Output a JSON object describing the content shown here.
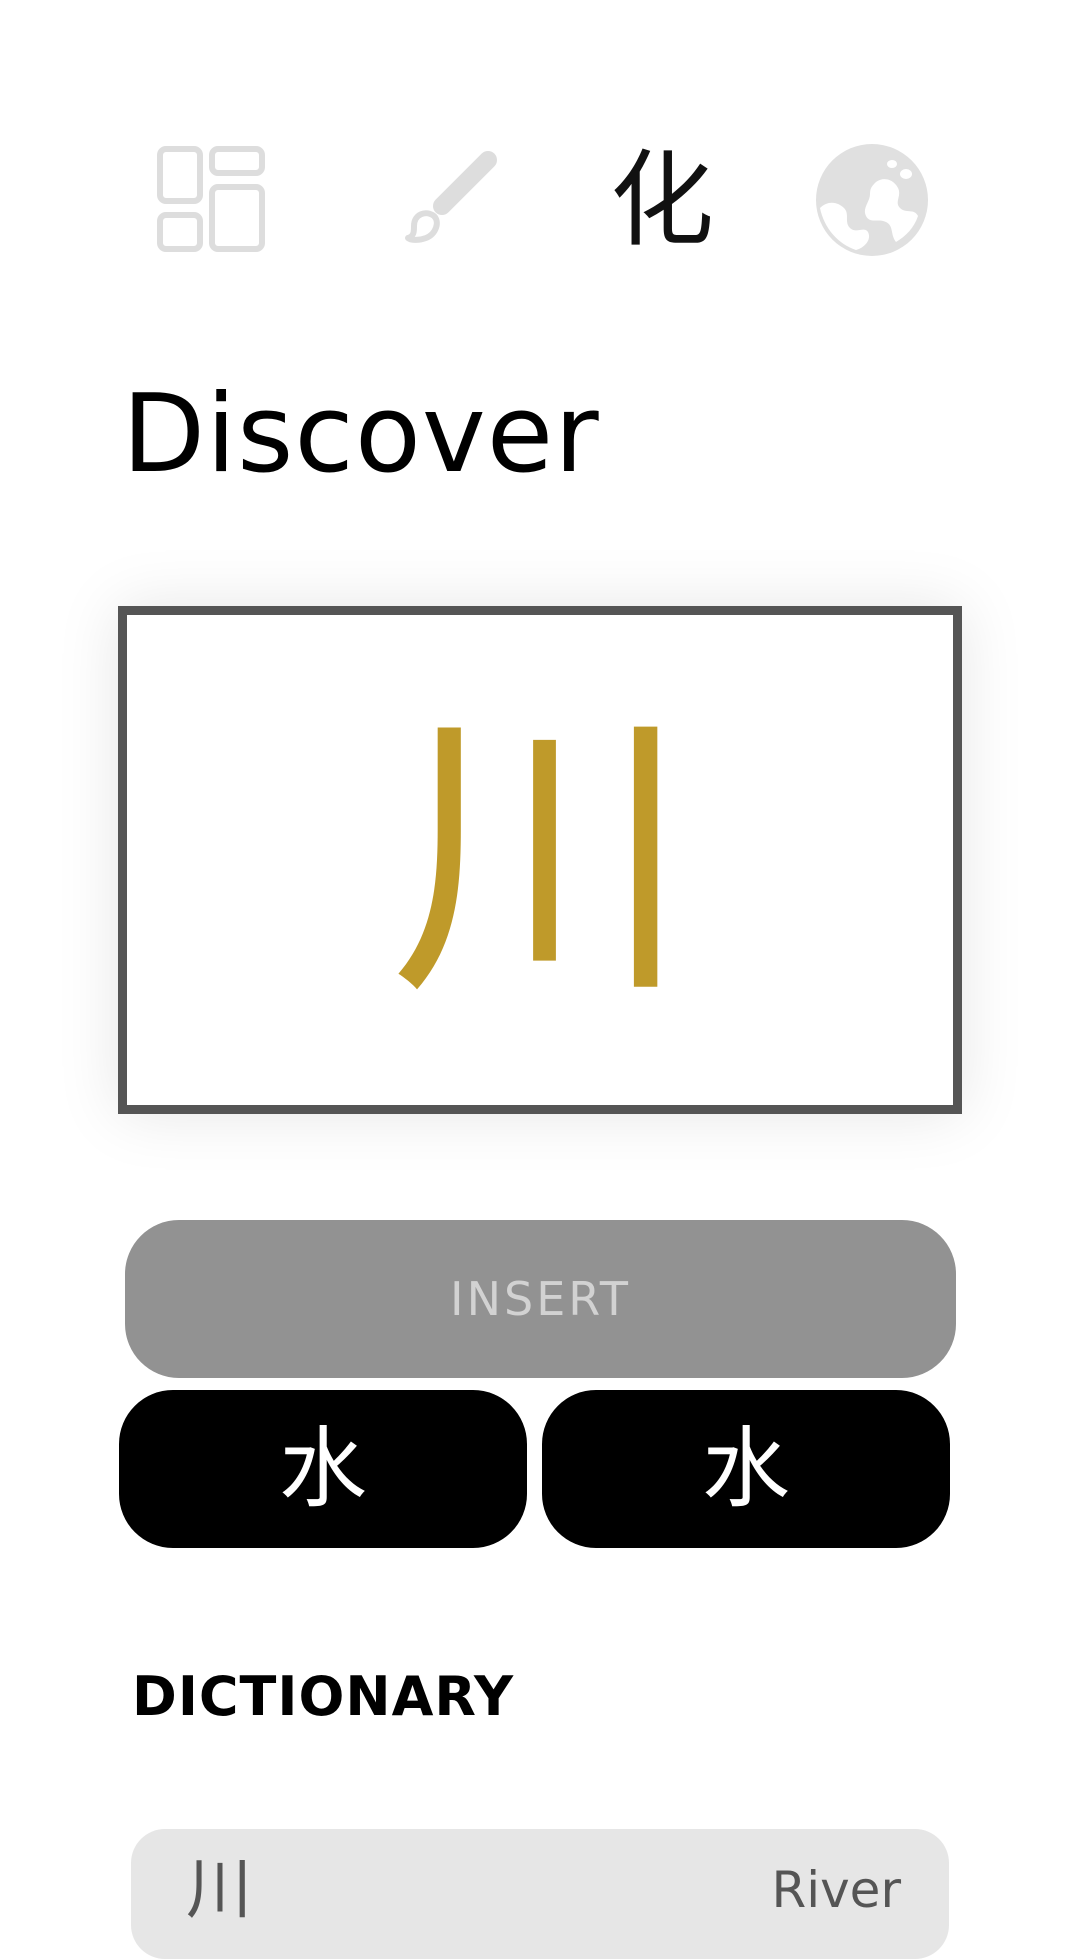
{
  "nav": {
    "items": [
      {
        "icon": "dashboard-icon",
        "active": false
      },
      {
        "icon": "brush-icon",
        "active": false
      },
      {
        "icon": "character-icon",
        "glyph": "化",
        "active": true
      },
      {
        "icon": "globe-icon",
        "active": false
      }
    ],
    "active_color": "#111111",
    "inactive_color": "#dddddd"
  },
  "page": {
    "title": "Discover"
  },
  "canvas": {
    "character": "川",
    "stroke_color": "#bf9a2a",
    "border_color": "#555555"
  },
  "actions": {
    "insert_label": "INSERT",
    "insert_enabled": false,
    "candidates": [
      "水",
      "水"
    ]
  },
  "dictionary": {
    "heading": "DICTIONARY",
    "entries": [
      {
        "character": "川",
        "meaning": "River"
      }
    ]
  }
}
